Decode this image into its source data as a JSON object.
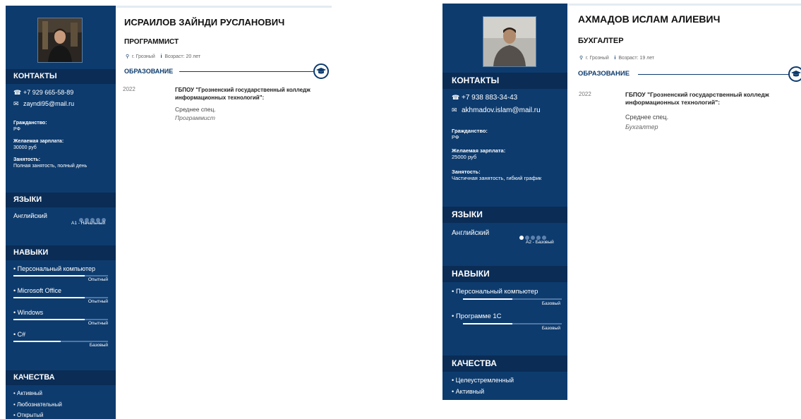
{
  "resumes": [
    {
      "name": "ИСРАИЛОВ ЗАЙНДИ РУСЛАНОВИЧ",
      "position": "ПРОГРАММИСТ",
      "city": "г. Грозный",
      "age": "Возраст: 20 лет",
      "contacts_title": "КОНТАКТЫ",
      "phone": "+7 929 665-58-89",
      "email": "zayndi95@mail.ru",
      "citizenship_label": "Гражданство:",
      "citizenship": "РФ",
      "salary_label": "Желаемая зарплата:",
      "salary": "30000 руб",
      "employment_label": "Занятость:",
      "employment": "Полная занятость, полный день",
      "languages_title": "ЯЗЫКИ",
      "languages": [
        {
          "name": "Английский",
          "level": "A1 - Начальный",
          "dots": 0
        }
      ],
      "skills_title": "НАВЫКИ",
      "skills": [
        {
          "name": "• Персональный компьютер",
          "level": "Опытный",
          "fill": 0.75
        },
        {
          "name": "• Microsoft Office",
          "level": "Опытный",
          "fill": 0.75
        },
        {
          "name": "• Windows",
          "level": "Опытный",
          "fill": 0.75
        },
        {
          "name": "• C#",
          "level": "Базовый",
          "fill": 0.5
        }
      ],
      "qualities_title": "КАЧЕСТВА",
      "qualities": [
        "• Активный",
        "• Любознательный",
        "• Открытый"
      ],
      "education_title": "ОБРАЗОВАНИЕ",
      "education": {
        "year": "2022",
        "institution": "ГБПОУ \"Грозненский государственный колледж информационных технологий\":",
        "degree": "Среднее спец.",
        "specialty": "Программист"
      }
    },
    {
      "name": "АХМАДОВ ИСЛАМ АЛИЕВИЧ",
      "position": "БУХГАЛТЕР",
      "city": "г. Грозный",
      "age": "Возраст: 19 лет",
      "contacts_title": "КОНТАКТЫ",
      "phone": "+7 938 883-34-43",
      "email": "akhmadov.islam@mail.ru",
      "citizenship_label": "Гражданство:",
      "citizenship": "РФ",
      "salary_label": "Желаемая зарплата:",
      "salary": "25000 руб",
      "employment_label": "Занятость:",
      "employment": "Частичная занятость, гибкий график",
      "languages_title": "ЯЗЫКИ",
      "languages": [
        {
          "name": "Английский",
          "level": "A2 - Базовый",
          "dots": 1
        }
      ],
      "skills_title": "НАВЫКИ",
      "skills": [
        {
          "name": "• Персональный компьютер",
          "level": "Базовый",
          "fill": 0.5
        },
        {
          "name": "• Программе 1С",
          "level": "Базовый",
          "fill": 0.5
        }
      ],
      "qualities_title": "КАЧЕСТВА",
      "qualities": [
        "• Целеустремленный",
        "• Активный"
      ],
      "education_title": "ОБРАЗОВАНИЕ",
      "education": {
        "year": "2022",
        "institution": "ГБПОУ \"Грозненский государственный колледж информационных технологий\":",
        "degree": "Среднее спец.",
        "specialty": "Бухгалтер"
      }
    }
  ],
  "icons": {
    "phone": "phone-icon",
    "email": "envelope-icon",
    "location": "map-pin-icon",
    "info": "info-icon",
    "education": "graduation-cap-icon"
  },
  "colors": {
    "sidebar": "#0d3b6e",
    "section_header": "#0a2c55",
    "accent": "#0d3b6e"
  }
}
